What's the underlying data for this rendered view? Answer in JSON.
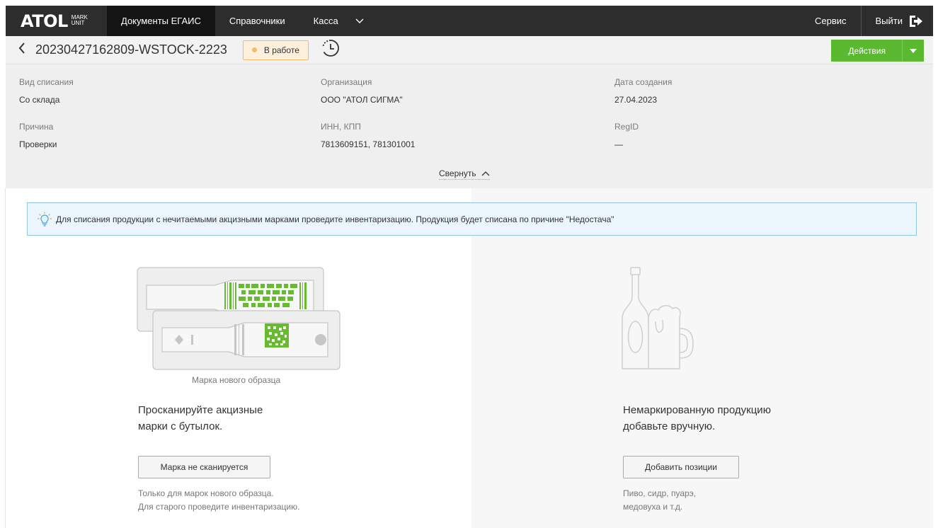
{
  "app": {
    "logo": "ATOL",
    "logo_sub_1": "MARK",
    "logo_sub_2": "UNIT"
  },
  "nav": {
    "items": [
      {
        "label": "Документы ЕГАИС",
        "active": true
      },
      {
        "label": "Справочники",
        "active": false
      },
      {
        "label": "Касса",
        "active": false
      }
    ],
    "service_label": "Сервис",
    "exit_label": "Выйти"
  },
  "doc": {
    "title": "20230427162809-WSTOCK-2223",
    "status": "В работе",
    "actions_label": "Действия"
  },
  "info": {
    "writeoff_type_label": "Вид списания",
    "writeoff_type_value": "Со склада",
    "organization_label": "Организация",
    "organization_value": "ООО \"АТОЛ СИГМА\"",
    "created_label": "Дата создания",
    "created_value": "27.04.2023",
    "reason_label": "Причина",
    "reason_value": "Проверки",
    "inn_label": "ИНН, КПП",
    "inn_value": "7813609151, 781301001",
    "regid_label": "RegID",
    "regid_value": "—",
    "collapse_label": "Свернуть"
  },
  "hint": {
    "text": "Для списания продукции с нечитаемыми акцизными марками проведите инвентаризацию. Продукция будет списана по причине \"Недостача\""
  },
  "left": {
    "caption": "Марка нового образца",
    "title_line1": "Просканируйте акцизные",
    "title_line2": "марки с бутылок.",
    "button": "Марка не сканируется",
    "note_line1": "Только для марок нового образца.",
    "note_line2": "Для старого проведите инвентаризацию."
  },
  "right": {
    "title_line1": "Немаркированную продукцию",
    "title_line2": "добавьте вручную.",
    "button": "Добавить позиции",
    "note_line1": "Пиво, сидр, пуарэ,",
    "note_line2": "медовуха и т.д."
  },
  "colors": {
    "nav_bg": "#2d2d2d",
    "accent_green": "#5bb831",
    "status_orange": "#f4b870",
    "hint_bg": "#eaf5fc"
  }
}
